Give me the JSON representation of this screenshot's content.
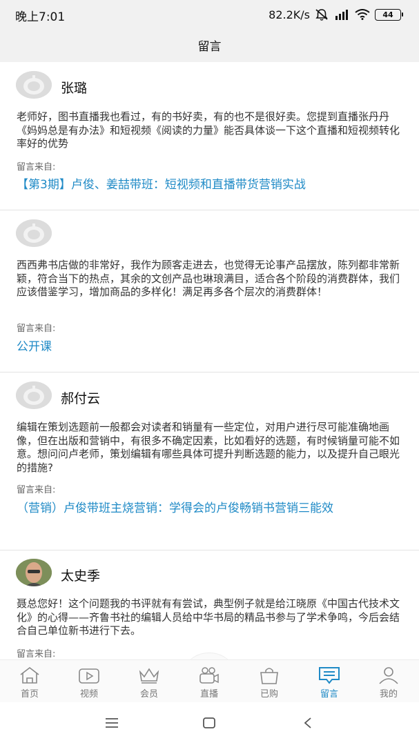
{
  "status_bar": {
    "time": "晚上7:01",
    "net_speed": "82.2K/s",
    "battery": "44"
  },
  "page_title": "留言",
  "comments": [
    {
      "user": "张璐",
      "avatar": "default-avatar",
      "text": "老师好，图书直播我也看过，有的书好卖，有的也不是很好卖。您提到直播张丹丹《妈妈总是有办法》和短视频《阅读的力量》能否具体谈一下这个直播和短视频转化率好的优势",
      "source_label": "留言来自:",
      "source": "【第3期】卢俊、姜喆带班：短视频和直播带货营销实战"
    },
    {
      "user": "",
      "avatar": "default-avatar",
      "text": "西西弗书店做的非常好，我作为顾客走进去，也觉得无论事产品摆放，陈列都非常新颖，符合当下的热点，其余的文创产品也琳琅满目，适合各个阶段的消费群体，我们应该借鉴学习，增加商品的多样化！满足再多各个层次的消费群体！",
      "source_label": "留言来自:",
      "source": "公开课"
    },
    {
      "user": "郝付云",
      "avatar": "default-avatar",
      "text": "编辑在策划选题前一般都会对读者和销量有一些定位，对用户进行尽可能准确地画像，但在出版和营销中，有很多不确定因素，比如看好的选题，有时候销量可能不如意。想问问卢老师，策划编辑有哪些具体可提升判断选题的能力，以及提升自己眼光的措施?",
      "source_label": "留言来自:",
      "source": "（营销）卢俊带班主烧营销：学得会的卢俊畅销书营销三能效"
    },
    {
      "user": "太史季",
      "avatar": "photo-avatar",
      "text": "聂总您好！这个问题我的书评就有有尝试，典型例子就是给江晓原《中国古代技术文化》的心得——齐鲁书社的编辑人员给中华书局的精品书参与了学术争鸣，今后会结合自己单位新书进行下去。",
      "source_label": "留言来自:",
      "source": ""
    }
  ],
  "tabs": [
    {
      "label": "首页",
      "icon": "home-icon"
    },
    {
      "label": "视频",
      "icon": "video-icon"
    },
    {
      "label": "会员",
      "icon": "crown-icon"
    },
    {
      "label": "直播",
      "icon": "camera-icon"
    },
    {
      "label": "已购",
      "icon": "bag-icon"
    },
    {
      "label": "留言",
      "icon": "message-icon",
      "active": true
    },
    {
      "label": "我的",
      "icon": "user-icon"
    }
  ],
  "colors": {
    "accent": "#1f8ac6",
    "header_bg": "#f1f1f1",
    "divider": "#e3e3e3"
  }
}
